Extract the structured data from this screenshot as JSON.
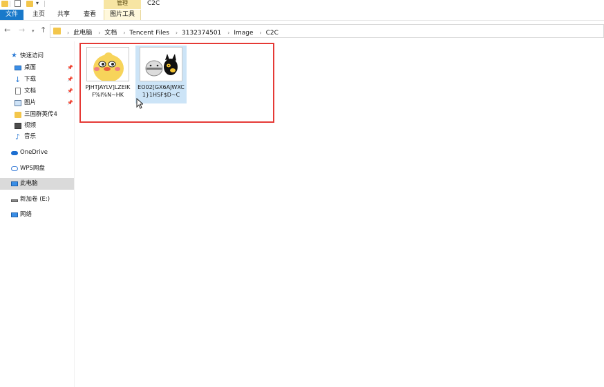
{
  "window": {
    "title": "C2C",
    "contextual_tab_group": "管理"
  },
  "ribbon": {
    "tabs": [
      {
        "label": "文件"
      },
      {
        "label": "主页"
      },
      {
        "label": "共享"
      },
      {
        "label": "查看"
      },
      {
        "label": "图片工具"
      }
    ]
  },
  "address": {
    "breadcrumbs": [
      "此电脑",
      "文档",
      "Tencent Files",
      "3132374501",
      "Image",
      "C2C"
    ]
  },
  "sidebar": {
    "items": [
      {
        "label": "快速访问",
        "icon": "star-icon"
      },
      {
        "label": "桌面",
        "icon": "desktop-icon",
        "pinned": true
      },
      {
        "label": "下载",
        "icon": "download-icon",
        "pinned": true
      },
      {
        "label": "文档",
        "icon": "document-icon",
        "pinned": true
      },
      {
        "label": "图片",
        "icon": "pictures-icon",
        "pinned": true
      },
      {
        "label": "三国群英传4",
        "icon": "folder-icon"
      },
      {
        "label": "视频",
        "icon": "video-icon"
      },
      {
        "label": "音乐",
        "icon": "music-icon"
      },
      {
        "label": "OneDrive",
        "icon": "onedrive-cloud-icon"
      },
      {
        "label": "WPS网盘",
        "icon": "wps-cloud-icon"
      },
      {
        "label": "此电脑",
        "icon": "computer-icon",
        "selected": true
      },
      {
        "label": "新加卷 (E:)",
        "icon": "drive-icon"
      },
      {
        "label": "网络",
        "icon": "network-icon"
      }
    ]
  },
  "files": [
    {
      "name": "PJHTJAYLV]LZEIKF%I%N~HK",
      "thumbnail": "yellow-chick-emoji",
      "selected": false
    },
    {
      "name": "EO02[GX6AJWXC1}1HSF$D~C",
      "thumbnail": "penguin-and-black-cat-emoji",
      "selected": true
    }
  ],
  "colors": {
    "file_tab": "#1979ca",
    "contextual_tab": "#f7e5a3",
    "selection": "#cce4f7",
    "highlight_box": "#e53935"
  }
}
